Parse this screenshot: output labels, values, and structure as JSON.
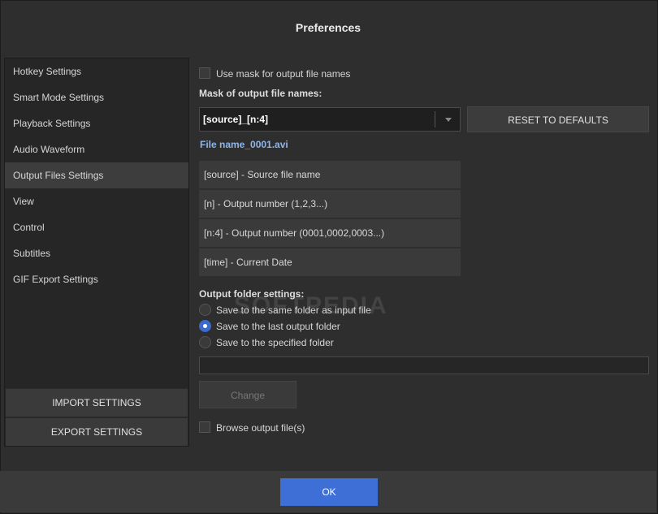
{
  "window": {
    "title": "Preferences"
  },
  "sidebar": {
    "items": [
      {
        "label": "Hotkey Settings",
        "active": false
      },
      {
        "label": "Smart Mode Settings",
        "active": false
      },
      {
        "label": "Playback Settings",
        "active": false
      },
      {
        "label": "Audio Waveform",
        "active": false
      },
      {
        "label": "Output Files Settings",
        "active": true
      },
      {
        "label": "View",
        "active": false
      },
      {
        "label": "Control",
        "active": false
      },
      {
        "label": "Subtitles",
        "active": false
      },
      {
        "label": "GIF Export Settings",
        "active": false
      }
    ],
    "import_label": "IMPORT SETTINGS",
    "export_label": "EXPORT SETTINGS"
  },
  "main": {
    "use_mask_label": "Use mask for output file names",
    "use_mask_checked": false,
    "mask_heading": "Mask of output file names:",
    "mask_value": "[source]_[n:4]",
    "reset_label": "RESET TO DEFAULTS",
    "preview_filename": "File name_0001.avi",
    "mask_tags": [
      "[source] - Source file name",
      "[n] - Output number (1,2,3...)",
      "[n:4] - Output number (0001,0002,0003...)",
      "[time] - Current Date"
    ],
    "folder_heading": "Output folder settings:",
    "folder_options": [
      {
        "label": "Save to the same folder as input file",
        "selected": false
      },
      {
        "label": "Save to the last output folder",
        "selected": true
      },
      {
        "label": "Save to the specified folder",
        "selected": false
      }
    ],
    "folder_path": "",
    "change_label": "Change",
    "browse_label": "Browse output file(s)",
    "browse_checked": false
  },
  "footer": {
    "ok_label": "OK"
  },
  "watermark": "SOFTPEDIA",
  "colors": {
    "accent": "#3d6fd6",
    "link": "#8fb6e8",
    "background": "#2e2e2e"
  }
}
